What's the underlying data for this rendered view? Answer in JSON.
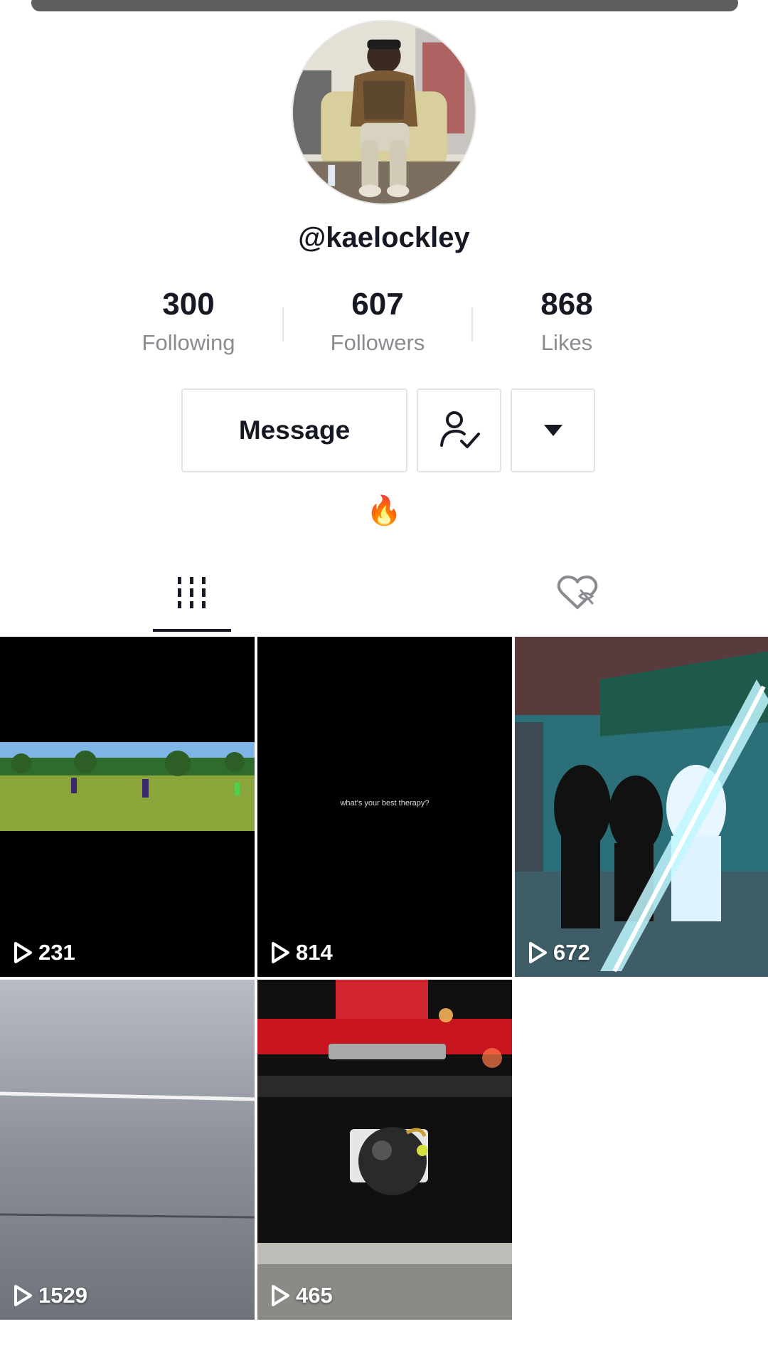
{
  "profile": {
    "username": "@kaelockley",
    "bio": "🔥"
  },
  "stats": [
    {
      "value": "300",
      "label": "Following"
    },
    {
      "value": "607",
      "label": "Followers"
    },
    {
      "value": "868",
      "label": "Likes"
    }
  ],
  "actions": {
    "message_label": "Message",
    "follow_icon": "user-check-icon",
    "more_icon": "caret-down-icon"
  },
  "tabs": [
    {
      "name": "videos",
      "icon": "grid-icon",
      "active": true
    },
    {
      "name": "liked",
      "icon": "heart-hidden-icon",
      "active": false
    }
  ],
  "videos": [
    {
      "views": "231"
    },
    {
      "views": "814",
      "overlay_text": "what's your best therapy?"
    },
    {
      "views": "672"
    },
    {
      "views": "1529"
    },
    {
      "views": "465"
    }
  ]
}
